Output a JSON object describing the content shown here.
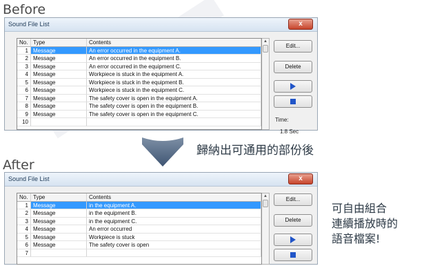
{
  "before": {
    "section_label": "Before",
    "window_title": "Sound File List",
    "close_label": "x",
    "columns": {
      "no": "No.",
      "type": "Type",
      "contents": "Contents"
    },
    "rows": [
      {
        "no": "1",
        "type": "Message",
        "contents": "An error occurred in the equipment A.",
        "selected": true
      },
      {
        "no": "2",
        "type": "Message",
        "contents": "An error occurred in the equipment B."
      },
      {
        "no": "3",
        "type": "Message",
        "contents": "An error occurred in the equipment C."
      },
      {
        "no": "4",
        "type": "Message",
        "contents": "Workpiece is stuck in the equipment A."
      },
      {
        "no": "5",
        "type": "Message",
        "contents": "Workpiece is stuck in the equipment B."
      },
      {
        "no": "6",
        "type": "Message",
        "contents": "Workpiece is stuck in the equipment C."
      },
      {
        "no": "7",
        "type": "Message",
        "contents": "The safety cover is open in the equipment A."
      },
      {
        "no": "8",
        "type": "Message",
        "contents": "The safety cover is open in the equipment B."
      },
      {
        "no": "9",
        "type": "Message",
        "contents": "The safety cover is open in the equipment C."
      },
      {
        "no": "10",
        "type": "",
        "contents": ""
      }
    ],
    "buttons": {
      "edit": "Edit...",
      "delete": "Delete"
    },
    "time_label": "Time:",
    "time_value": "1.8 Sec"
  },
  "after": {
    "section_label": "After",
    "window_title": "Sound File List",
    "close_label": "x",
    "columns": {
      "no": "No.",
      "type": "Type",
      "contents": "Contents"
    },
    "rows": [
      {
        "no": "1",
        "type": "Message",
        "contents": "in the equipment A.",
        "selected": true
      },
      {
        "no": "2",
        "type": "Message",
        "contents": "in the equipment B."
      },
      {
        "no": "3",
        "type": "Message",
        "contents": "in the equipment C."
      },
      {
        "no": "4",
        "type": "Message",
        "contents": "An error occurred"
      },
      {
        "no": "5",
        "type": "Message",
        "contents": "Workpiece is stuck"
      },
      {
        "no": "6",
        "type": "Message",
        "contents": "The safety cover is open"
      },
      {
        "no": "7",
        "type": "",
        "contents": ""
      }
    ],
    "buttons": {
      "edit": "Edit...",
      "delete": "Delete"
    }
  },
  "annotations": {
    "arrow_caption": "歸納出可通用的部份後",
    "side_note": [
      "可自由組合",
      "連續播放時的",
      "語音檔案!"
    ]
  },
  "icons": {
    "play": "play-icon",
    "stop": "stop-icon",
    "arrow": "down-arrow-icon"
  },
  "colors": {
    "selection": "#3399ff",
    "play_stop": "#2155c8",
    "close": "#c7442b"
  }
}
